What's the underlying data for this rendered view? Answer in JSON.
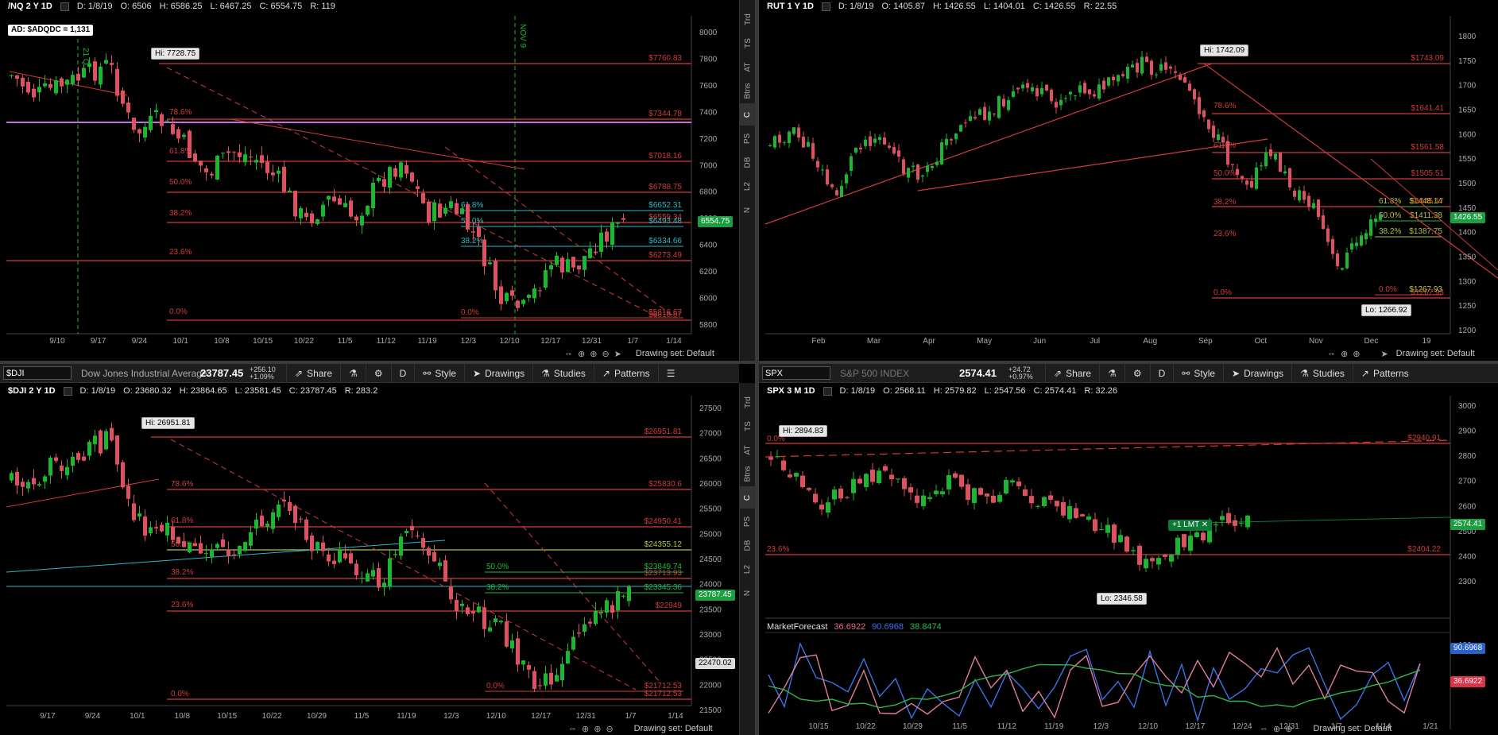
{
  "colors": {
    "up": "#1bb82f",
    "down": "#e0515f",
    "fib": "#d23a3a",
    "cyan": "#27b9c9",
    "magenta": "#c76be0",
    "olive": "#b6c23a",
    "grid": "#2a2a2a"
  },
  "icons": {
    "cursor": "cursor-arrow-icon",
    "zoom": "zoom-icon",
    "pan": "pan-arrows-icon",
    "crosshair": "crosshair-icon",
    "draw": "drawing-pen-icon",
    "beaker": "studies-beaker-icon",
    "gear": "gear-icon"
  },
  "sidebar_tabs": [
    "Trd",
    "TS",
    "AT",
    "Btns",
    "C",
    "PS",
    "DB",
    "L2",
    "N"
  ],
  "drawing_set_label": "Drawing set: Default",
  "nq": {
    "header": {
      "symbol": "/NQ 2 Y 1D",
      "d": "D: 1/8/19",
      "o": "O: 6506",
      "h": "H: 6586.25",
      "l": "L: 6467.25",
      "c": "C: 6554.75",
      "r": "R: 119"
    },
    "ad_label": "AD: $ADQDC = 1,131",
    "hi": "Hi: 7728.75",
    "price_tag": "6554.75",
    "y_ticks": [
      "8000",
      "7800",
      "7600",
      "7400",
      "7200",
      "7000",
      "6800",
      "6600",
      "6400",
      "6200",
      "6000",
      "5800"
    ],
    "x_ticks": [
      "9/10",
      "9/17",
      "9/24",
      "10/1",
      "10/8",
      "10/15",
      "10/22",
      "11/5",
      "11/12",
      "11/19",
      "12/3",
      "12/10",
      "12/17",
      "12/31",
      "1/7",
      "1/14"
    ],
    "fib_left": [
      "78.6%",
      "61.8%",
      "50.0%",
      "38.2%",
      "23.6%",
      "0.0%"
    ],
    "fib_right": [
      "$7760.83",
      "$7344.78",
      "$7018.16",
      "$6788.75",
      "$6559.34",
      "$6273.49",
      "$5816.67"
    ],
    "fib2_left": [
      "61.8%",
      "50.0%",
      "38.2%",
      "0.0%"
    ],
    "fib2_right": [
      "$6652.31",
      "$6493.48",
      "$6334.66",
      "$5816.67"
    ],
    "vlabels": [
      "21 Q",
      "NOV 9"
    ]
  },
  "rut": {
    "header": {
      "symbol": "RUT 1 Y 1D",
      "d": "D: 1/8/19",
      "o": "O: 1405.87",
      "h": "H: 1426.55",
      "l": "L: 1404.01",
      "c": "C: 1426.55",
      "r": "R: 22.55"
    },
    "hi": "Hi: 1742.09",
    "lo": "Lo: 1266.92",
    "price_tag": "1426.55",
    "y_ticks": [
      "1800",
      "1750",
      "1700",
      "1650",
      "1600",
      "1550",
      "1500",
      "1450",
      "1400",
      "1350",
      "1300",
      "1250",
      "1200"
    ],
    "x_ticks": [
      "Feb",
      "Mar",
      "Apr",
      "May",
      "Jun",
      "Jul",
      "Aug",
      "Sep",
      "Oct",
      "Nov",
      "Dec",
      "19"
    ],
    "fib_left": [
      "78.6%",
      "61.8%",
      "50.0%",
      "38.2%",
      "23.6%",
      "0.0%"
    ],
    "fib_right": [
      "$1743.09",
      "$1641.41",
      "$1561.58",
      "$1505.51",
      "$1445.17",
      "$1267.93"
    ],
    "fib2_left": [
      "61.8%",
      "50.0%",
      "38.2%",
      "0.0%"
    ],
    "fib2_right": [
      "$1448.14",
      "$1411.38",
      "$1387.75",
      "$1267.93"
    ]
  },
  "dji": {
    "toolbar": {
      "symbol": "$DJI",
      "description": "Dow Jones Industrial Average",
      "price": "23787.45",
      "change": "+256.10",
      "change_pct": "+1.09%",
      "period": "D",
      "share": "Share",
      "style": "Style",
      "drawings": "Drawings",
      "studies": "Studies",
      "patterns": "Patterns"
    },
    "header": {
      "symbol": "$DJI 2 Y 1D",
      "d": "D: 1/8/19",
      "o": "O: 23680.32",
      "h": "H: 23864.65",
      "l": "L: 23581.45",
      "c": "C: 23787.45",
      "r": "R: 283.2"
    },
    "hi": "Hi: 26951.81",
    "price_tag": "23787.45",
    "gray_tag": "22470.02",
    "y_ticks": [
      "27500",
      "27000",
      "26500",
      "26000",
      "25500",
      "25000",
      "24500",
      "24000",
      "23500",
      "23000",
      "22500",
      "22000",
      "21500"
    ],
    "x_ticks": [
      "9/17",
      "9/24",
      "10/1",
      "10/8",
      "10/15",
      "10/22",
      "10/29",
      "11/5",
      "11/19",
      "12/3",
      "12/10",
      "12/17",
      "12/31",
      "1/7",
      "1/14"
    ],
    "fib_left": [
      "78.6%",
      "61.8%",
      "50.0%",
      "38.2%",
      "23.6%",
      "0.0%"
    ],
    "fib_right": [
      "$26951.81",
      "$25830.6",
      "$24950.41",
      "$24355.12",
      "$23713.93",
      "$22949",
      "$21712.53"
    ],
    "fib2_left": [
      "61.8%",
      "50.0%",
      "38.2%",
      "0.0%"
    ],
    "fib2_right": [
      "$23849.74",
      "$23345.36",
      "$21712.53"
    ]
  },
  "spx": {
    "toolbar": {
      "symbol": "SPX",
      "description": "S&P 500 INDEX",
      "price": "2574.41",
      "change": "+24.72",
      "change_pct": "+0.97%",
      "period": "D",
      "share": "Share",
      "style": "Style",
      "drawings": "Drawings",
      "studies": "Studies",
      "patterns": "Patterns"
    },
    "header": {
      "symbol": "SPX 3 M 1D",
      "d": "D: 1/8/19",
      "o": "O: 2568.11",
      "h": "H: 2579.82",
      "l": "L: 2547.56",
      "c": "C: 2574.41",
      "r": "R: 32.26"
    },
    "hi": "Hi: 2894.83",
    "lo": "Lo: 2346.58",
    "price_tag": "2574.41",
    "lmt": "+1 LMT",
    "y_ticks": [
      "3000",
      "2900",
      "2800",
      "2700",
      "2600",
      "2500",
      "2400",
      "2300"
    ],
    "x_ticks": [
      "10/15",
      "10/22",
      "10/29",
      "11/5",
      "11/12",
      "11/19",
      "12/3",
      "12/10",
      "12/17",
      "12/24",
      "12/31",
      "1/7",
      "1/14",
      "1/21"
    ],
    "fib_left": [
      "0.0%",
      "23.6%"
    ],
    "fib_right": [
      "$2940.91",
      "$2404.22"
    ],
    "study": {
      "name": "MarketForecast",
      "v1": "36.6922",
      "v2": "90.6968",
      "v3": "38.8474",
      "tag_blue": "90.6968",
      "tag_red": "36.6922",
      "axis": [
        "100"
      ]
    }
  }
}
